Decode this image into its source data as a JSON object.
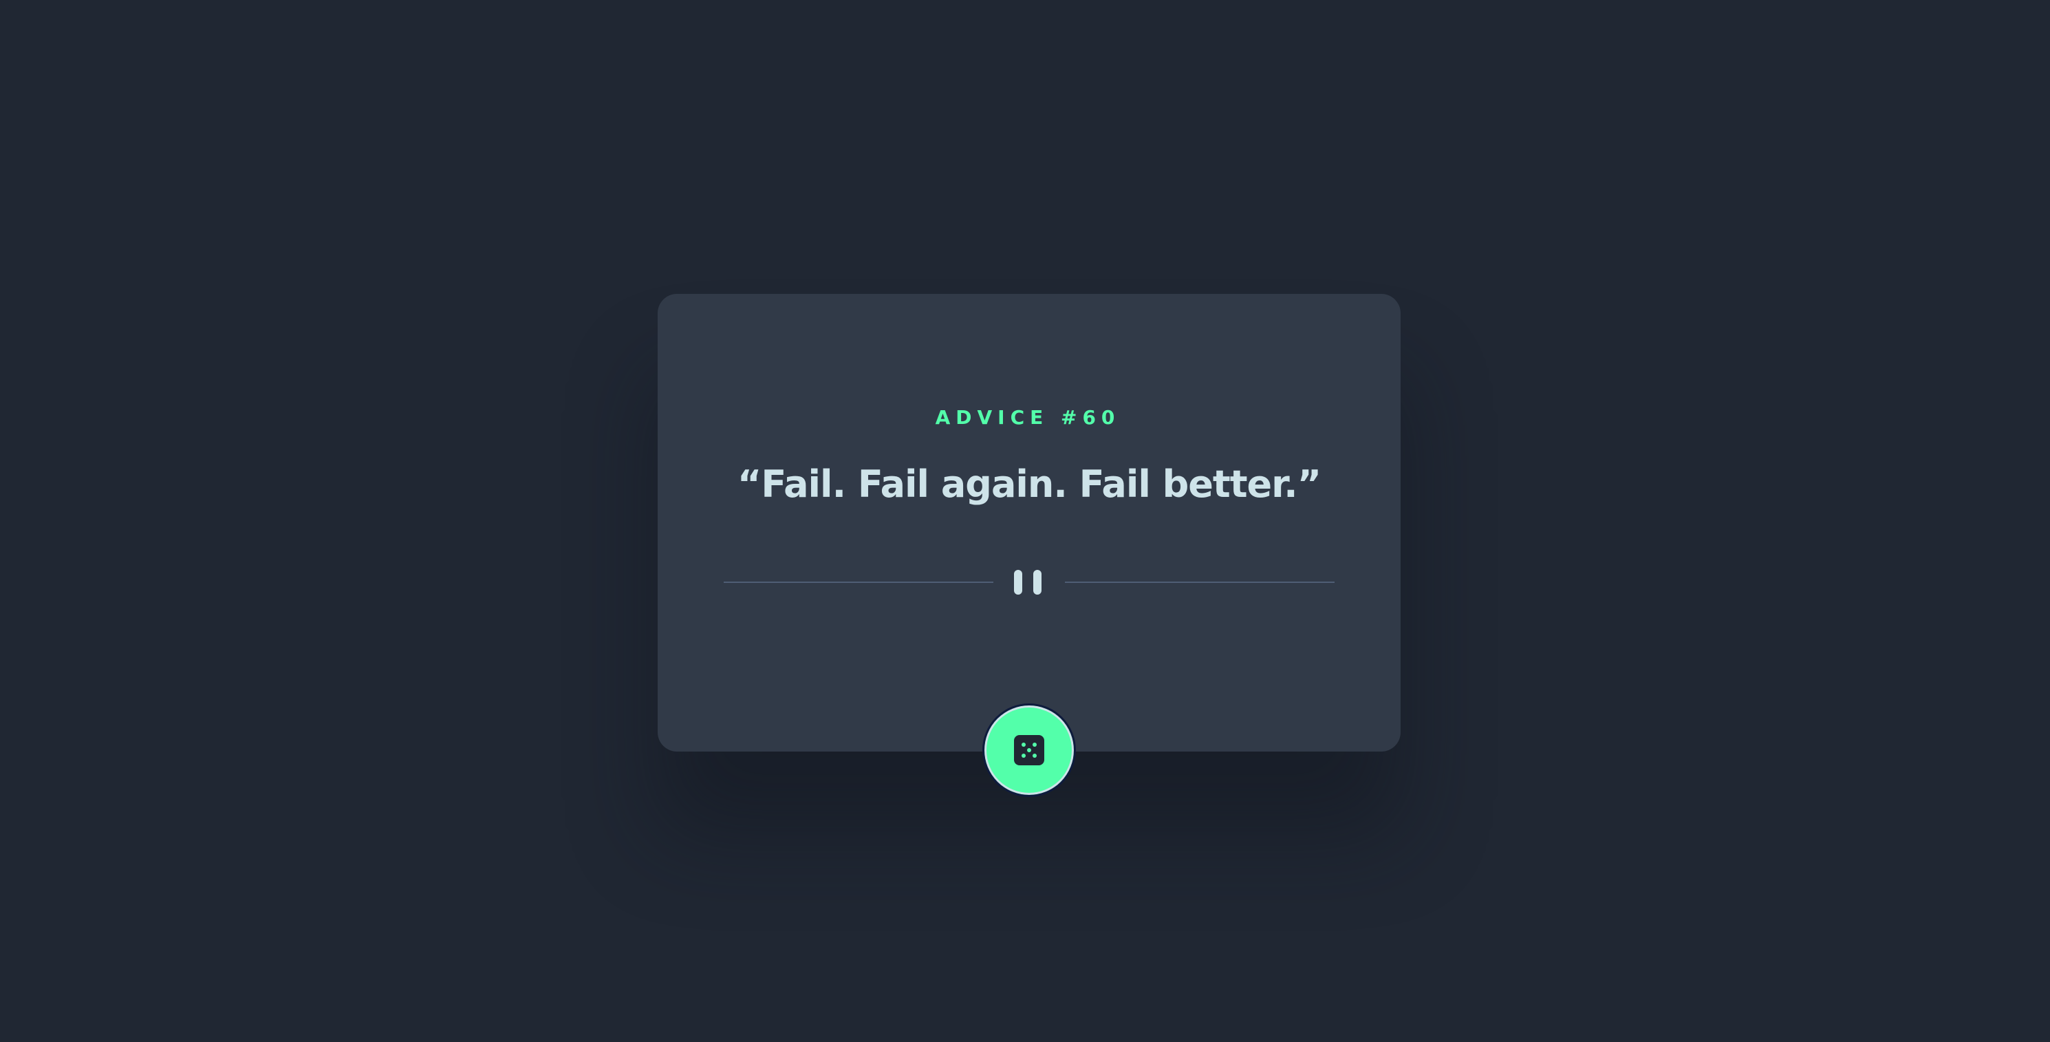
{
  "advice": {
    "label": "ADVICE #60",
    "quote": "“Fail. Fail again. Fail better.”"
  },
  "divider": {
    "icon": "pause-icon"
  },
  "action": {
    "icon": "dice-icon",
    "accent": "#53FFAA"
  },
  "colors": {
    "background": "#202733",
    "card": "#313A48",
    "text": "#CEE3E9",
    "accent": "#53FFAA",
    "divider": "#4F5D74"
  }
}
